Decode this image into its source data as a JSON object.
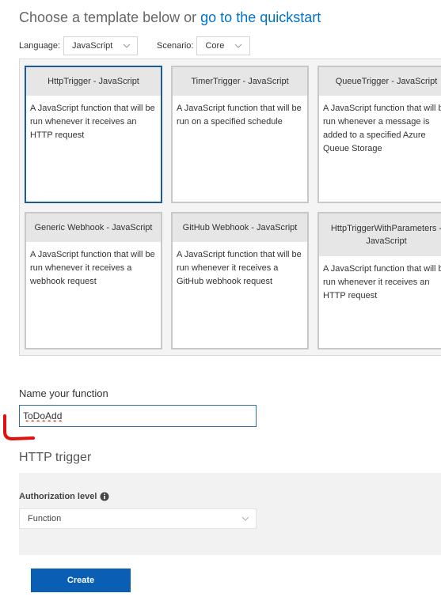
{
  "header": {
    "prefix": "Choose a template below or",
    "link": "go to the quickstart"
  },
  "filters": {
    "language_label": "Language:",
    "language_value": "JavaScript",
    "scenario_label": "Scenario:",
    "scenario_value": "Core"
  },
  "templates": [
    {
      "title": "HttpTrigger - JavaScript",
      "description": "A JavaScript function that will be run whenever it receives an HTTP request",
      "selected": true
    },
    {
      "title": "TimerTrigger - JavaScript",
      "description": "A JavaScript function that will be run on a specified schedule"
    },
    {
      "title": "QueueTrigger - JavaScript",
      "description": "A JavaScript function that will be run whenever a message is added to a specified Azure Queue Storage"
    },
    {
      "title": "Generic Webhook - JavaScript",
      "description": "A JavaScript function that will be run whenever it receives a webhook request"
    },
    {
      "title": "GitHub Webhook - JavaScript",
      "description": "A JavaScript function that will be run whenever it receives a GitHub webhook request"
    },
    {
      "title": "HttpTriggerWithParameters - JavaScript",
      "description": "A JavaScript function that will be run whenever it receives an HTTP request"
    }
  ],
  "name_section": {
    "label": "Name your function",
    "value": "ToDoAdd"
  },
  "trigger_section": {
    "title": "HTTP trigger",
    "auth_label": "Authorization level",
    "auth_value": "Function"
  },
  "create_button": "Create",
  "icons": {
    "chevron": "chevron-down-icon",
    "info": "info-icon"
  },
  "colors": {
    "accent": "#0a5fb4",
    "link": "#0072c6",
    "selected_border": "#1e5a9a",
    "annotation": "#e01010"
  }
}
